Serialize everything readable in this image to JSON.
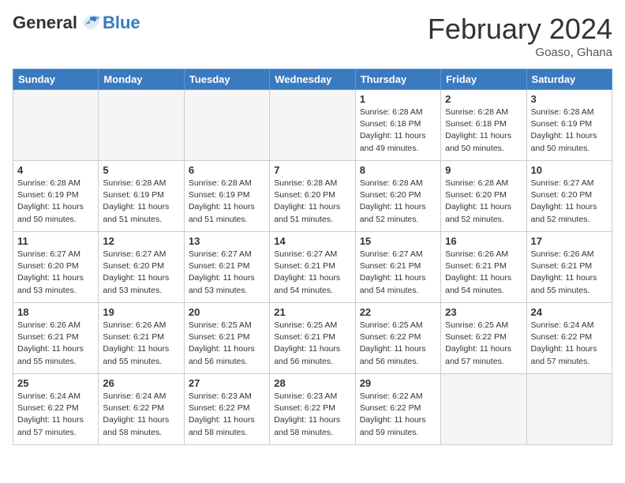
{
  "header": {
    "logo_general": "General",
    "logo_blue": "Blue",
    "month_year": "February 2024",
    "location": "Goaso, Ghana"
  },
  "weekdays": [
    "Sunday",
    "Monday",
    "Tuesday",
    "Wednesday",
    "Thursday",
    "Friday",
    "Saturday"
  ],
  "weeks": [
    [
      {
        "day": "",
        "info": "",
        "empty": true
      },
      {
        "day": "",
        "info": "",
        "empty": true
      },
      {
        "day": "",
        "info": "",
        "empty": true
      },
      {
        "day": "",
        "info": "",
        "empty": true
      },
      {
        "day": "1",
        "info": "Sunrise: 6:28 AM\nSunset: 6:18 PM\nDaylight: 11 hours and 49 minutes.",
        "empty": false
      },
      {
        "day": "2",
        "info": "Sunrise: 6:28 AM\nSunset: 6:18 PM\nDaylight: 11 hours and 50 minutes.",
        "empty": false
      },
      {
        "day": "3",
        "info": "Sunrise: 6:28 AM\nSunset: 6:19 PM\nDaylight: 11 hours and 50 minutes.",
        "empty": false
      }
    ],
    [
      {
        "day": "4",
        "info": "Sunrise: 6:28 AM\nSunset: 6:19 PM\nDaylight: 11 hours and 50 minutes.",
        "empty": false
      },
      {
        "day": "5",
        "info": "Sunrise: 6:28 AM\nSunset: 6:19 PM\nDaylight: 11 hours and 51 minutes.",
        "empty": false
      },
      {
        "day": "6",
        "info": "Sunrise: 6:28 AM\nSunset: 6:19 PM\nDaylight: 11 hours and 51 minutes.",
        "empty": false
      },
      {
        "day": "7",
        "info": "Sunrise: 6:28 AM\nSunset: 6:20 PM\nDaylight: 11 hours and 51 minutes.",
        "empty": false
      },
      {
        "day": "8",
        "info": "Sunrise: 6:28 AM\nSunset: 6:20 PM\nDaylight: 11 hours and 52 minutes.",
        "empty": false
      },
      {
        "day": "9",
        "info": "Sunrise: 6:28 AM\nSunset: 6:20 PM\nDaylight: 11 hours and 52 minutes.",
        "empty": false
      },
      {
        "day": "10",
        "info": "Sunrise: 6:27 AM\nSunset: 6:20 PM\nDaylight: 11 hours and 52 minutes.",
        "empty": false
      }
    ],
    [
      {
        "day": "11",
        "info": "Sunrise: 6:27 AM\nSunset: 6:20 PM\nDaylight: 11 hours and 53 minutes.",
        "empty": false
      },
      {
        "day": "12",
        "info": "Sunrise: 6:27 AM\nSunset: 6:20 PM\nDaylight: 11 hours and 53 minutes.",
        "empty": false
      },
      {
        "day": "13",
        "info": "Sunrise: 6:27 AM\nSunset: 6:21 PM\nDaylight: 11 hours and 53 minutes.",
        "empty": false
      },
      {
        "day": "14",
        "info": "Sunrise: 6:27 AM\nSunset: 6:21 PM\nDaylight: 11 hours and 54 minutes.",
        "empty": false
      },
      {
        "day": "15",
        "info": "Sunrise: 6:27 AM\nSunset: 6:21 PM\nDaylight: 11 hours and 54 minutes.",
        "empty": false
      },
      {
        "day": "16",
        "info": "Sunrise: 6:26 AM\nSunset: 6:21 PM\nDaylight: 11 hours and 54 minutes.",
        "empty": false
      },
      {
        "day": "17",
        "info": "Sunrise: 6:26 AM\nSunset: 6:21 PM\nDaylight: 11 hours and 55 minutes.",
        "empty": false
      }
    ],
    [
      {
        "day": "18",
        "info": "Sunrise: 6:26 AM\nSunset: 6:21 PM\nDaylight: 11 hours and 55 minutes.",
        "empty": false
      },
      {
        "day": "19",
        "info": "Sunrise: 6:26 AM\nSunset: 6:21 PM\nDaylight: 11 hours and 55 minutes.",
        "empty": false
      },
      {
        "day": "20",
        "info": "Sunrise: 6:25 AM\nSunset: 6:21 PM\nDaylight: 11 hours and 56 minutes.",
        "empty": false
      },
      {
        "day": "21",
        "info": "Sunrise: 6:25 AM\nSunset: 6:21 PM\nDaylight: 11 hours and 56 minutes.",
        "empty": false
      },
      {
        "day": "22",
        "info": "Sunrise: 6:25 AM\nSunset: 6:22 PM\nDaylight: 11 hours and 56 minutes.",
        "empty": false
      },
      {
        "day": "23",
        "info": "Sunrise: 6:25 AM\nSunset: 6:22 PM\nDaylight: 11 hours and 57 minutes.",
        "empty": false
      },
      {
        "day": "24",
        "info": "Sunrise: 6:24 AM\nSunset: 6:22 PM\nDaylight: 11 hours and 57 minutes.",
        "empty": false
      }
    ],
    [
      {
        "day": "25",
        "info": "Sunrise: 6:24 AM\nSunset: 6:22 PM\nDaylight: 11 hours and 57 minutes.",
        "empty": false
      },
      {
        "day": "26",
        "info": "Sunrise: 6:24 AM\nSunset: 6:22 PM\nDaylight: 11 hours and 58 minutes.",
        "empty": false
      },
      {
        "day": "27",
        "info": "Sunrise: 6:23 AM\nSunset: 6:22 PM\nDaylight: 11 hours and 58 minutes.",
        "empty": false
      },
      {
        "day": "28",
        "info": "Sunrise: 6:23 AM\nSunset: 6:22 PM\nDaylight: 11 hours and 58 minutes.",
        "empty": false
      },
      {
        "day": "29",
        "info": "Sunrise: 6:22 AM\nSunset: 6:22 PM\nDaylight: 11 hours and 59 minutes.",
        "empty": false
      },
      {
        "day": "",
        "info": "",
        "empty": true
      },
      {
        "day": "",
        "info": "",
        "empty": true
      }
    ]
  ]
}
